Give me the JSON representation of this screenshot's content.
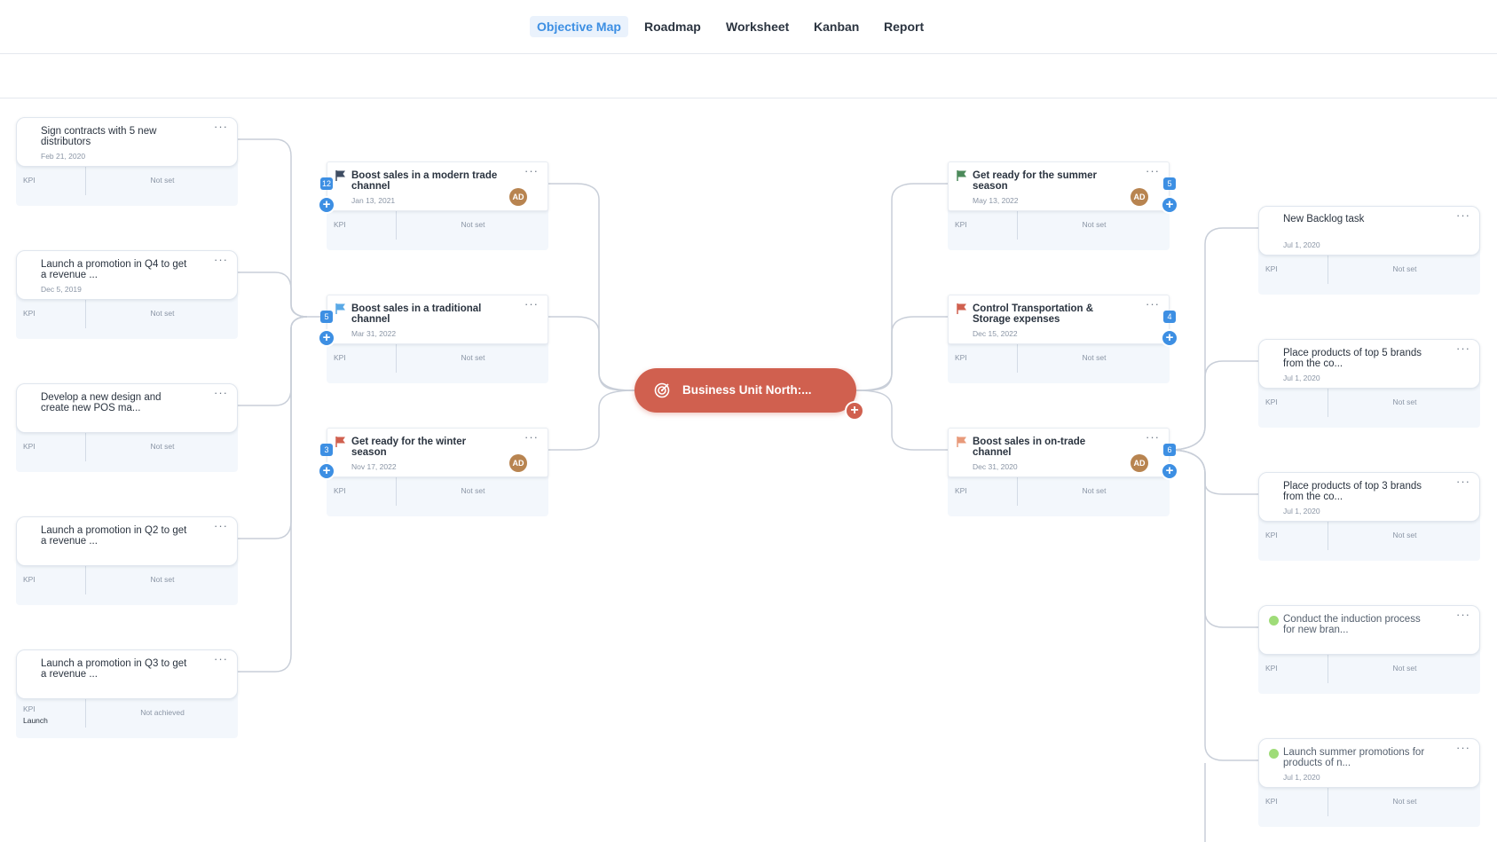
{
  "nav": {
    "tabs": [
      "Objective Map",
      "Roadmap",
      "Worksheet",
      "Kanban",
      "Report"
    ],
    "active": "Objective Map"
  },
  "root": {
    "title": "Business Unit North:...",
    "color": "#d0604f"
  },
  "colors": {
    "accent": "#3d8fe3",
    "link": "#c8ced8",
    "kpi_bg": "#f3f7fc",
    "avatar": "#b88450",
    "status_green": "#9fdc78"
  },
  "left_tasks": [
    {
      "title": "Sign contracts with 5 new distributors",
      "date": "Feb 21, 2020",
      "kpi": "KPI",
      "kpi_value": "Not set"
    },
    {
      "title": "Launch a promotion in Q4 to get a revenue ...",
      "date": "Dec 5, 2019",
      "kpi": "KPI",
      "kpi_value": "Not set"
    },
    {
      "title": "Develop a new design and create new POS ma...",
      "date": "",
      "kpi": "KPI",
      "kpi_value": "Not set"
    },
    {
      "title": "Launch a promotion in Q2 to get a revenue ...",
      "date": "",
      "kpi": "KPI",
      "kpi_value": "Not set"
    },
    {
      "title": "Launch a promotion in Q3 to get a revenue ...",
      "date": "",
      "kpi": "KPI",
      "kpi_name": "Launch",
      "kpi_value": "Not achieved"
    }
  ],
  "left_objectives": [
    {
      "title": "Boost sales in a modern trade  channel",
      "date": "Jan 13, 2021",
      "count": "12",
      "avatar": "AD",
      "flag_color": "#3f4d63",
      "kpi": "KPI",
      "kpi_value": "Not set"
    },
    {
      "title": "Boost sales in a traditional channel",
      "date": "Mar 31, 2022",
      "count": "5",
      "avatar": "",
      "flag_color": "#5aa9e6",
      "kpi": "KPI",
      "kpi_value": "Not set"
    },
    {
      "title": "Get ready for the winter season",
      "date": "Nov 17, 2022",
      "count": "3",
      "avatar": "AD",
      "flag_color": "#d0604f",
      "kpi": "KPI",
      "kpi_value": "Not set"
    }
  ],
  "right_objectives": [
    {
      "title": "Get ready for the summer season",
      "date": "May 13, 2022",
      "count": "5",
      "avatar": "AD",
      "flag_color": "#4c8a5a",
      "kpi": "KPI",
      "kpi_value": "Not set"
    },
    {
      "title": "Control Transportation & Storage expenses",
      "date": "Dec 15, 2022",
      "count": "4",
      "avatar": "",
      "flag_color": "#d0604f",
      "kpi": "KPI",
      "kpi_value": "Not set"
    },
    {
      "title": "Boost sales in on-trade channel",
      "date": "Dec 31, 2020",
      "count": "6",
      "avatar": "AD",
      "flag_color": "#e89a7a",
      "kpi": "KPI",
      "kpi_value": "Not set"
    }
  ],
  "right_tasks": [
    {
      "title": "New Backlog task",
      "date": "Jul 1, 2020",
      "status": "",
      "kpi": "KPI",
      "kpi_value": "Not set"
    },
    {
      "title": "Place products of top 5 brands from the co...",
      "date": "Jul 1, 2020",
      "status": "",
      "kpi": "KPI",
      "kpi_value": "Not set"
    },
    {
      "title": "Place products of top 3 brands from the co...",
      "date": "Jul 1, 2020",
      "status": "",
      "kpi": "KPI",
      "kpi_value": "Not set"
    },
    {
      "title": "Conduct the induction process for new bran...",
      "date": "",
      "status": "green",
      "kpi": "KPI",
      "kpi_value": "Not set"
    },
    {
      "title": "Launch summer promotions for products of n...",
      "date": "Jul 1, 2020",
      "status": "green",
      "kpi": "KPI",
      "kpi_value": "Not set"
    }
  ]
}
